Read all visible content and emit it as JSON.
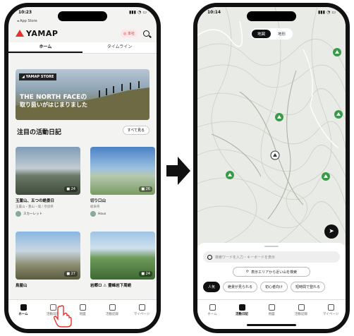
{
  "left_phone": {
    "time": "10:23",
    "back_app": "◂ App Store",
    "logo": "YAMAP",
    "badge": "◎ 本社",
    "tabs": [
      "ホーム",
      "タイムライン"
    ],
    "banner": {
      "store_tag": "◢ YAMAP STORE",
      "line1": "THE NORTH FACEの",
      "line2": "取り扱いがはじまりました"
    },
    "section_title": "注目の活動日記",
    "see_all": "すべて見る",
    "cards": [
      {
        "title": "玉置山、五つの絶景日",
        "sub": "玉置山・豊山・城 / 奈良県",
        "user": "スカーレット",
        "count": "■ 24"
      },
      {
        "title": "切り口山",
        "sub": "岐阜県",
        "user": "Hous",
        "count": "■ 26"
      },
      {
        "title": "鳥屋山",
        "sub": "",
        "user": "",
        "count": "■ 27"
      },
      {
        "title": "岩郷ロ ⚠ 霊峰岩下周絶",
        "sub": "",
        "user": "",
        "count": "■ 24"
      }
    ],
    "nav": [
      "ホーム",
      "活動日記",
      "地図",
      "活動記録",
      "マイページ"
    ]
  },
  "right_phone": {
    "time": "10:14",
    "map_toggle": [
      "地図",
      "地形"
    ],
    "search_placeholder": "検索ワードを入力・キーボードを表示",
    "area_button": "表示エリアから近い山を検索",
    "chips": [
      "人気",
      "絶景が見られる",
      "初心者向け",
      "短時間で登れる"
    ],
    "nav": [
      "ホーム",
      "活動日記",
      "地図",
      "活動記録",
      "マイページ"
    ]
  },
  "colors": {
    "brand_red": "#e5322d",
    "dark": "#111111",
    "pin_green": "#3a9a4a"
  }
}
